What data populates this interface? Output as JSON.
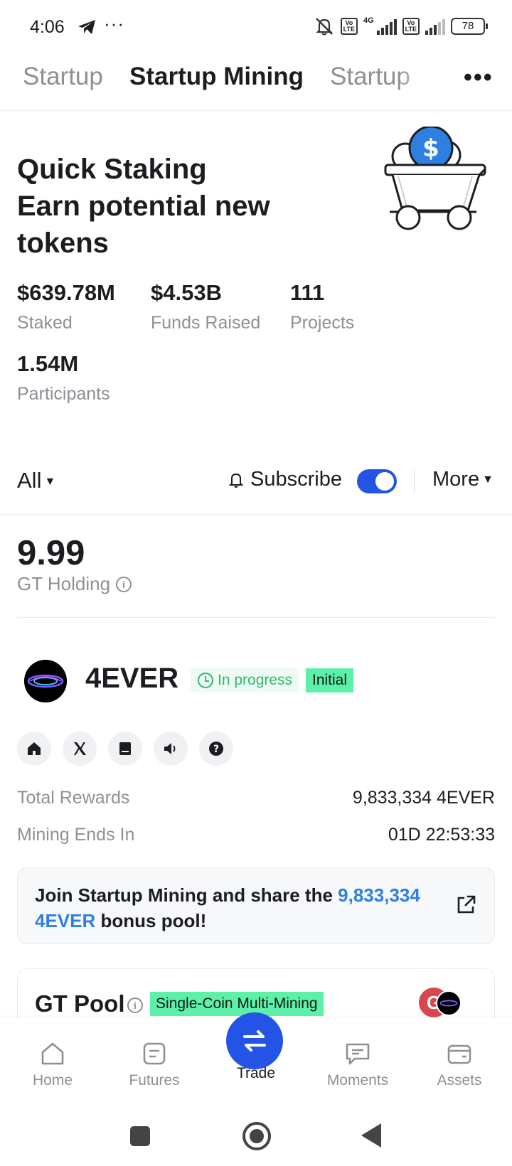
{
  "status_bar": {
    "time": "4:06",
    "dots": "···",
    "battery": "78",
    "net": "4G",
    "volte": "Vo LTE"
  },
  "tabs": [
    {
      "label": "Startup"
    },
    {
      "label": "Startup Mining"
    },
    {
      "label": "Startup"
    }
  ],
  "hero": {
    "title_line1": "Quick Staking",
    "title_line2": "Earn potential new",
    "title_line3": "tokens"
  },
  "stats": [
    {
      "value": "$639.78M",
      "label": "Staked"
    },
    {
      "value": "$4.53B",
      "label": "Funds Raised"
    },
    {
      "value": "111",
      "label": "Projects"
    },
    {
      "value": "1.54M",
      "label": "Participants"
    }
  ],
  "filter": {
    "all": "All",
    "subscribe": "Subscribe",
    "subscribe_on": true,
    "more": "More"
  },
  "gt_holding": {
    "value": "9.99",
    "label": "GT Holding"
  },
  "project": {
    "name": "4EVER",
    "status": "In progress",
    "tag": "Initial",
    "total_rewards_label": "Total Rewards",
    "total_rewards_value": "9,833,334 4EVER",
    "ends_label": "Mining Ends In",
    "ends_value": "01D 22:53:33",
    "join_prefix": "Join Startup Mining and share the ",
    "join_highlight": "9,833,334 4EVER",
    "join_suffix": " bonus pool!"
  },
  "pool": {
    "title": "GT Pool",
    "badge": "Single-Coin Multi-Mining"
  },
  "bottom_nav": [
    {
      "label": "Home"
    },
    {
      "label": "Futures"
    },
    {
      "label": "Trade"
    },
    {
      "label": "Moments"
    },
    {
      "label": "Assets"
    }
  ],
  "colors": {
    "accent": "#2354e6",
    "badge_green": "#5cf0a9",
    "status_green": "#2fb86e",
    "link_blue": "#2f7fe0"
  }
}
